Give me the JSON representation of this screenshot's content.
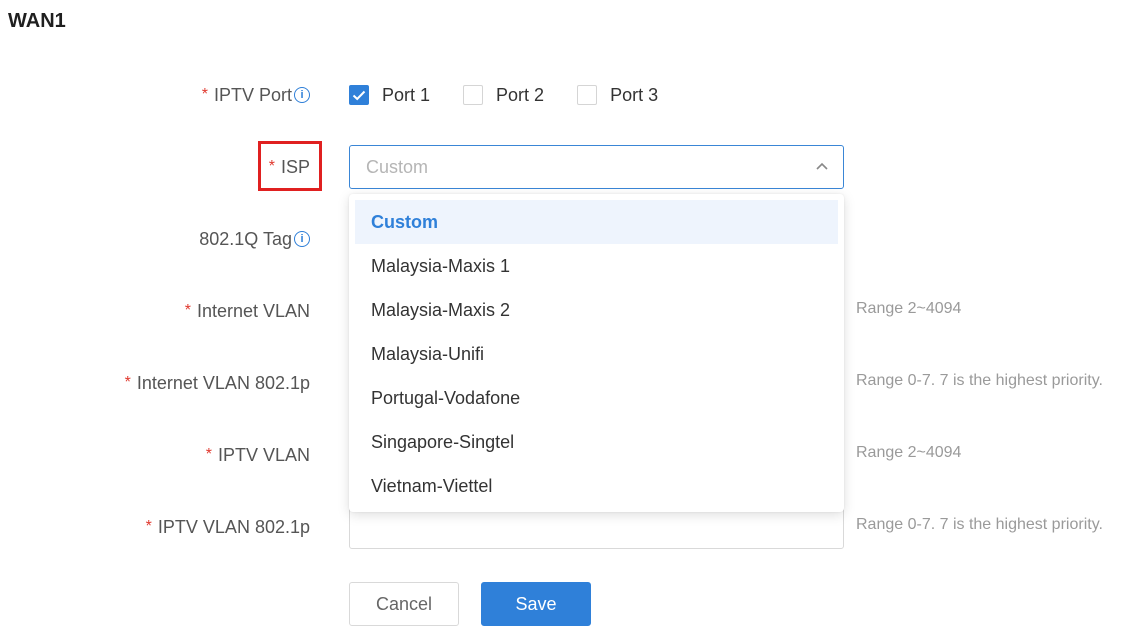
{
  "section": {
    "title": "WAN1"
  },
  "iptv_port": {
    "label": "IPTV Port",
    "ports": [
      {
        "label": "Port 1",
        "checked": true
      },
      {
        "label": "Port 2",
        "checked": false
      },
      {
        "label": "Port 3",
        "checked": false
      }
    ]
  },
  "isp": {
    "label": "ISP",
    "placeholder": "Custom",
    "options": [
      "Custom",
      "Malaysia-Maxis 1",
      "Malaysia-Maxis 2",
      "Malaysia-Unifi",
      "Portugal-Vodafone",
      "Singapore-Singtel",
      "Vietnam-Viettel"
    ],
    "selected_option": "Custom"
  },
  "tag_8021q": {
    "label": "802.1Q Tag"
  },
  "internet_vlan": {
    "label": "Internet VLAN",
    "hint": "Range 2~4094"
  },
  "internet_vlan_8021p": {
    "label": "Internet VLAN 802.1p",
    "hint": "Range 0-7. 7 is the highest priority."
  },
  "iptv_vlan": {
    "label": "IPTV VLAN",
    "hint": "Range 2~4094"
  },
  "iptv_vlan_8021p": {
    "label": "IPTV VLAN 802.1p",
    "hint": "Range 0-7. 7 is the highest priority."
  },
  "buttons": {
    "cancel": "Cancel",
    "save": "Save"
  },
  "colors": {
    "accent": "#2f80d9",
    "required": "#e0382e",
    "highlight": "#e02020"
  },
  "required_mark": "*",
  "info_glyph": "i"
}
